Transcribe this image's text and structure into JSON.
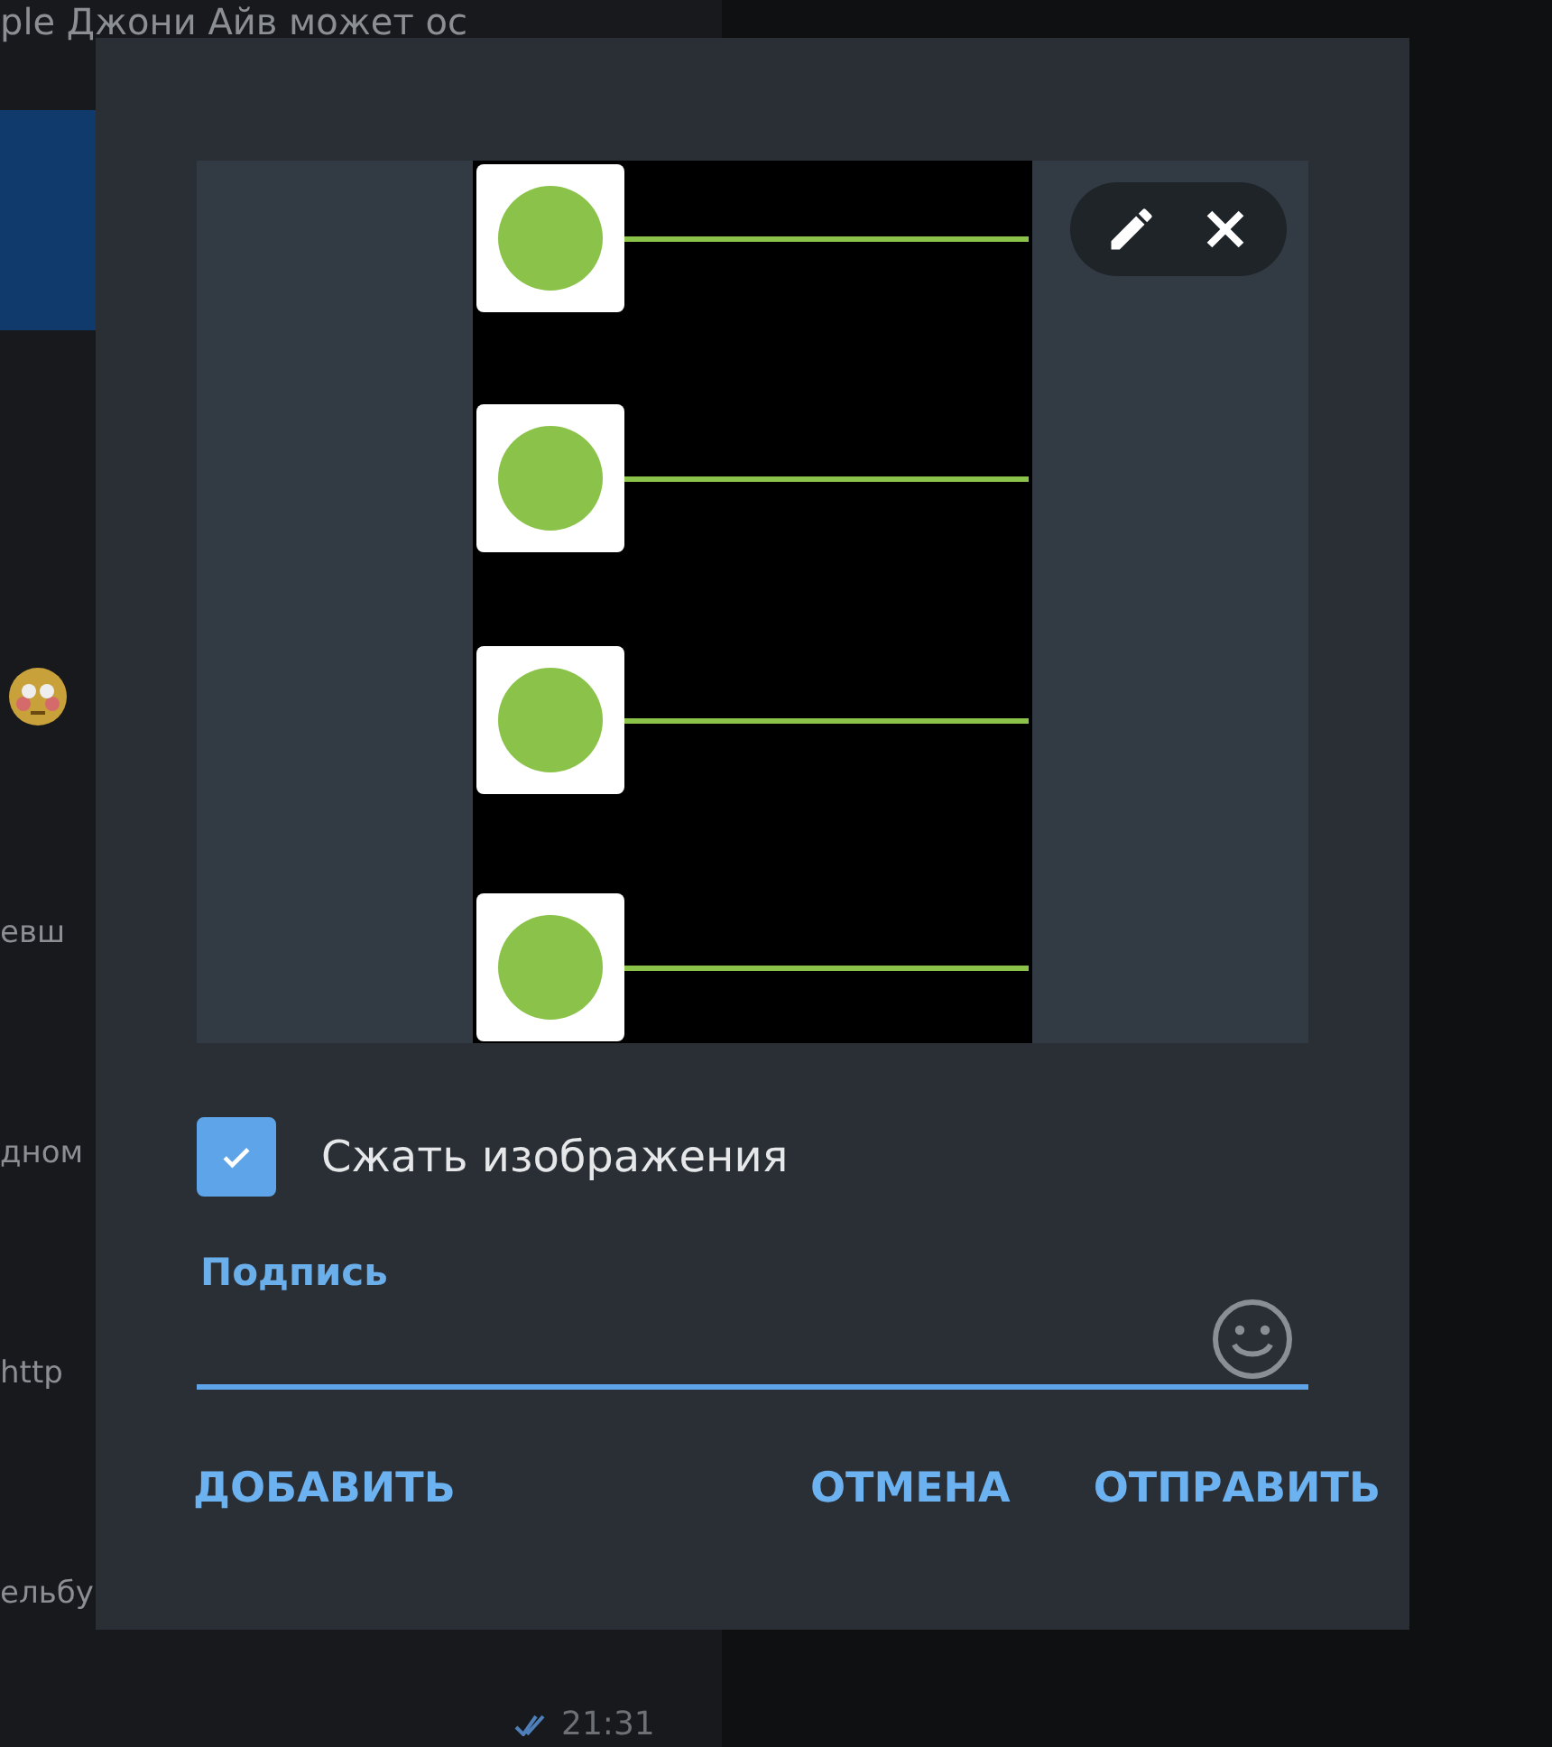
{
  "chat_list": [
    {
      "text": "ple Джони Айв может ос",
      "selected": false
    },
    {
      "selected": true
    },
    {
      "kind": "emoji",
      "selected": false
    },
    {
      "text": "евш",
      "selected": false
    },
    {
      "text": "дном",
      "selected": false
    },
    {
      "text": "http",
      "selected": false
    },
    {
      "text": "ельбу",
      "selected": false
    },
    {
      "time": "21:31",
      "selected": false
    }
  ],
  "dialog": {
    "compress": {
      "label": "Сжать изображения",
      "checked": true
    },
    "caption": {
      "label": "Подпись"
    },
    "buttons": [
      {
        "label": "ДОБАВИТЬ",
        "kind": "left"
      },
      {
        "label": "ОТМЕНА",
        "kind": "right"
      },
      {
        "label": "ОТПРАВИТЬ",
        "kind": "right"
      }
    ]
  }
}
